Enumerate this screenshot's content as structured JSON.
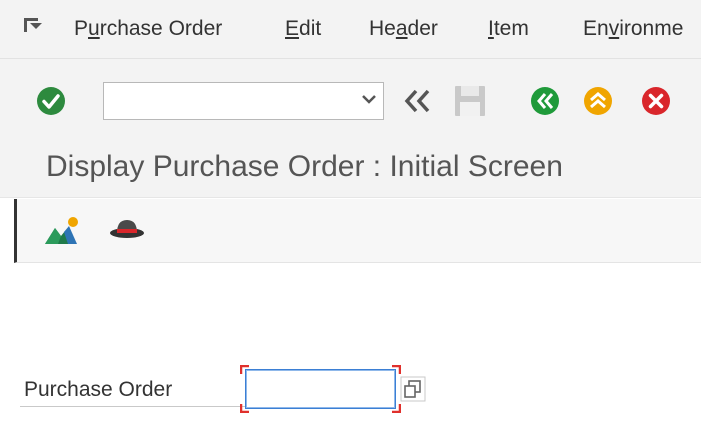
{
  "menu": {
    "items": [
      {
        "label_pre": "P",
        "label_ul": "u",
        "label_post": "rchase Order"
      },
      {
        "label_pre": "",
        "label_ul": "E",
        "label_post": "dit"
      },
      {
        "label_pre": "He",
        "label_ul": "a",
        "label_post": "der"
      },
      {
        "label_pre": "",
        "label_ul": "I",
        "label_post": "tem"
      },
      {
        "label_pre": "En",
        "label_ul": "v",
        "label_post": "ironme"
      }
    ]
  },
  "toolbar": {
    "command_field_value": "",
    "icons": [
      "enter-check-icon",
      "command-dropdown-icon",
      "collapse-left-icon",
      "save-icon",
      "back-icon",
      "exit-icon",
      "cancel-icon"
    ]
  },
  "page": {
    "title": "Display Purchase Order : Initial Screen"
  },
  "app_toolbar": {
    "icons": [
      "other-purchase-order-icon",
      "personal-settings-icon"
    ]
  },
  "form": {
    "purchase_order_label": "Purchase Order",
    "purchase_order_value": ""
  },
  "colors": {
    "enter_green": "#2d8a3e",
    "back_green": "#1f9a3a",
    "exit_orange": "#f0a500",
    "cancel_red": "#d9262b",
    "required_red": "#e0302c",
    "focus_blue": "#3b7fd4"
  }
}
